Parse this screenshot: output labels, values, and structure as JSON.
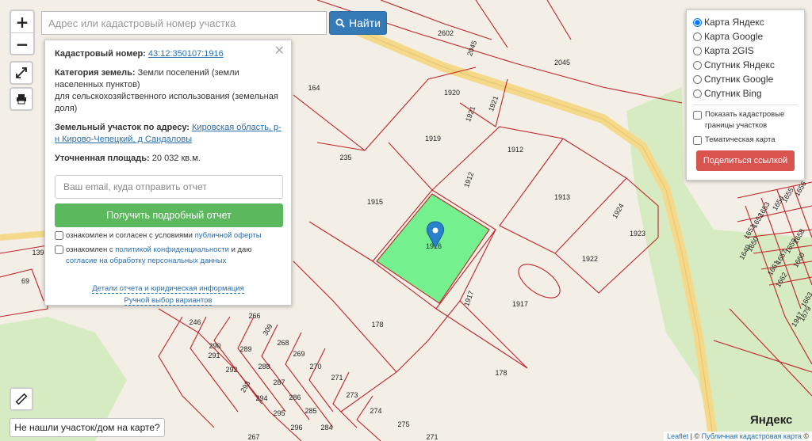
{
  "search": {
    "placeholder": "Адрес или кадастровый номер участка",
    "button_label": "Найти"
  },
  "zoom": {
    "in_label": "+",
    "out_label": "−"
  },
  "panel": {
    "cadastral_label": "Кадастровый номер:",
    "cadastral_value": "43:12:350107:1916",
    "category_label": "Категория земель:",
    "category_value": "Земли поселений (земли населенных пунктов)",
    "category_extra": "для сельскохозяйственного использования (земельная доля)",
    "address_label": "Земельный участок по адресу:",
    "address_value": "Кировская область, р-н Кирово-Чепецкий, д Сандаловы",
    "area_label": "Уточненная площадь:",
    "area_value": "20 032 кв.м.",
    "email_placeholder": "Ваш email, куда отправить отчет",
    "get_report_label": "Получить подробный отчет",
    "check1_text": "ознакомлен и согласен с условиями",
    "check1_link": "публичной оферты",
    "check2_text": "ознакомлен с",
    "check2_link1": "политикой конфиденциальности",
    "check2_mid": "и даю",
    "check2_link2": "согласие на обработку персональных данных",
    "details_link": "Детали отчета и юридическая информация",
    "manual_link": "Ручной выбор вариантов"
  },
  "layers": {
    "options": [
      "Карта Яндекс",
      "Карта Google",
      "Карта 2GIS",
      "Спутник Яндекс",
      "Спутник Google",
      "Спутник Bing"
    ],
    "selected": "Карта Яндекс",
    "show_borders": "Показать кадастровые границы участков",
    "thematic": "Тематическая карта",
    "share_label": "Поделиться ссылкой"
  },
  "not_found_label": "Не нашли участок/дом на карте?",
  "attribution": {
    "leaflet": "Leaflet",
    "sep": "| ©",
    "source": "Публичная кадастровая карта",
    "tail": "©"
  },
  "yandex_logo": "Яндекс",
  "parcels": [
    "2602",
    "2045",
    "2045",
    "164",
    "235",
    "1920",
    "1921",
    "1921",
    "1919",
    "1912",
    "1912",
    "1915",
    "1913",
    "1924",
    "1923",
    "1916",
    "1922",
    "1917",
    "1917",
    "178",
    "178",
    "139",
    "69",
    "246",
    "266",
    "309",
    "290",
    "291",
    "289",
    "268",
    "292",
    "288",
    "269",
    "270",
    "293",
    "287",
    "271",
    "294",
    "286",
    "273",
    "295",
    "285",
    "274",
    "296",
    "284",
    "275",
    "267",
    "271",
    "1656",
    "1655",
    "1654",
    "1653",
    "1652",
    "1651",
    "1650",
    "1649",
    "1658",
    "1659",
    "1657",
    "1660",
    "1661",
    "1662",
    "1663",
    "1679",
    "1947"
  ],
  "colors": {
    "parcel_border": "#c0232a",
    "selected_fill": "#74f08f",
    "road": "#f5d98a",
    "green": "#d7ebc2",
    "marker": "#2a81cb",
    "accent_blue": "#337ab7",
    "accent_green": "#5cb85c",
    "accent_red": "#d9534f"
  }
}
